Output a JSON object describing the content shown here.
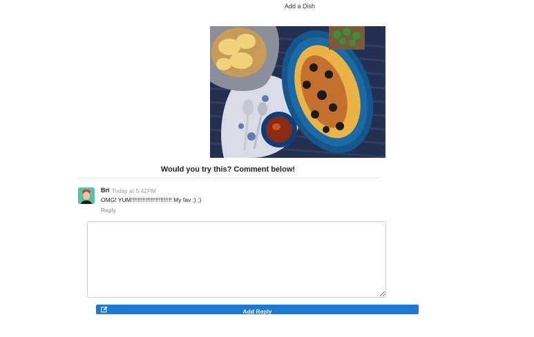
{
  "nav": {
    "add_dish_label": "Add a Dish"
  },
  "dish": {
    "photo_icon": "dish-photo"
  },
  "comments_section": {
    "heading": "Would you try this? Comment below!",
    "comments": [
      {
        "author": "Bri",
        "time": "Today at 5:42PM",
        "text": "OMG! YUM!!!!!!!!!!!!!!!!!!!!!!!!! My fav :) :)",
        "reply_label": "Reply"
      }
    ],
    "reply_form": {
      "textarea_value": "",
      "submit_label": "Add Reply",
      "submit_icon": "edit-icon"
    }
  },
  "colors": {
    "button": "#1f78d1",
    "avatar_bg": "#58c1a8",
    "muted_text": "#9a9a9a"
  }
}
